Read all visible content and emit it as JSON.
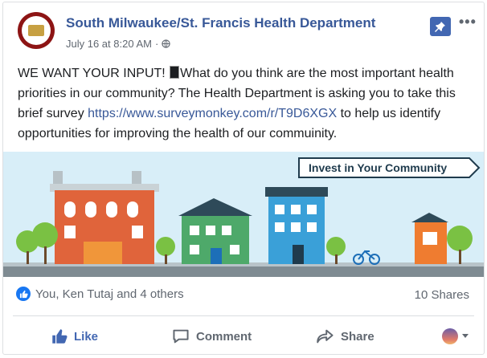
{
  "post": {
    "page_name": "South Milwaukee/St. Francis Health Department",
    "timestamp": "July 16 at 8:20 AM",
    "separator": "·",
    "more_label": "•••",
    "text_part1": "WE WANT YOUR INPUT! ",
    "text_part2": "What do you think are the most important health priorities in our community? The Health Department is asking you to take this brief survey ",
    "link": "https://www.surveymonkey.com/r/T9D6XGX",
    "text_part3": " to help us identify opportunities for improving the health of our commuinity.",
    "image_banner_text": "Invest in Your Community"
  },
  "engagement": {
    "reactions_text": "You, Ken Tutaj and 4 others",
    "shares_text": "10 Shares"
  },
  "actions": {
    "like": "Like",
    "comment": "Comment",
    "share": "Share"
  },
  "colors": {
    "link": "#385898",
    "like_active": "#4267b2",
    "facebook_blue": "#1877f2"
  }
}
